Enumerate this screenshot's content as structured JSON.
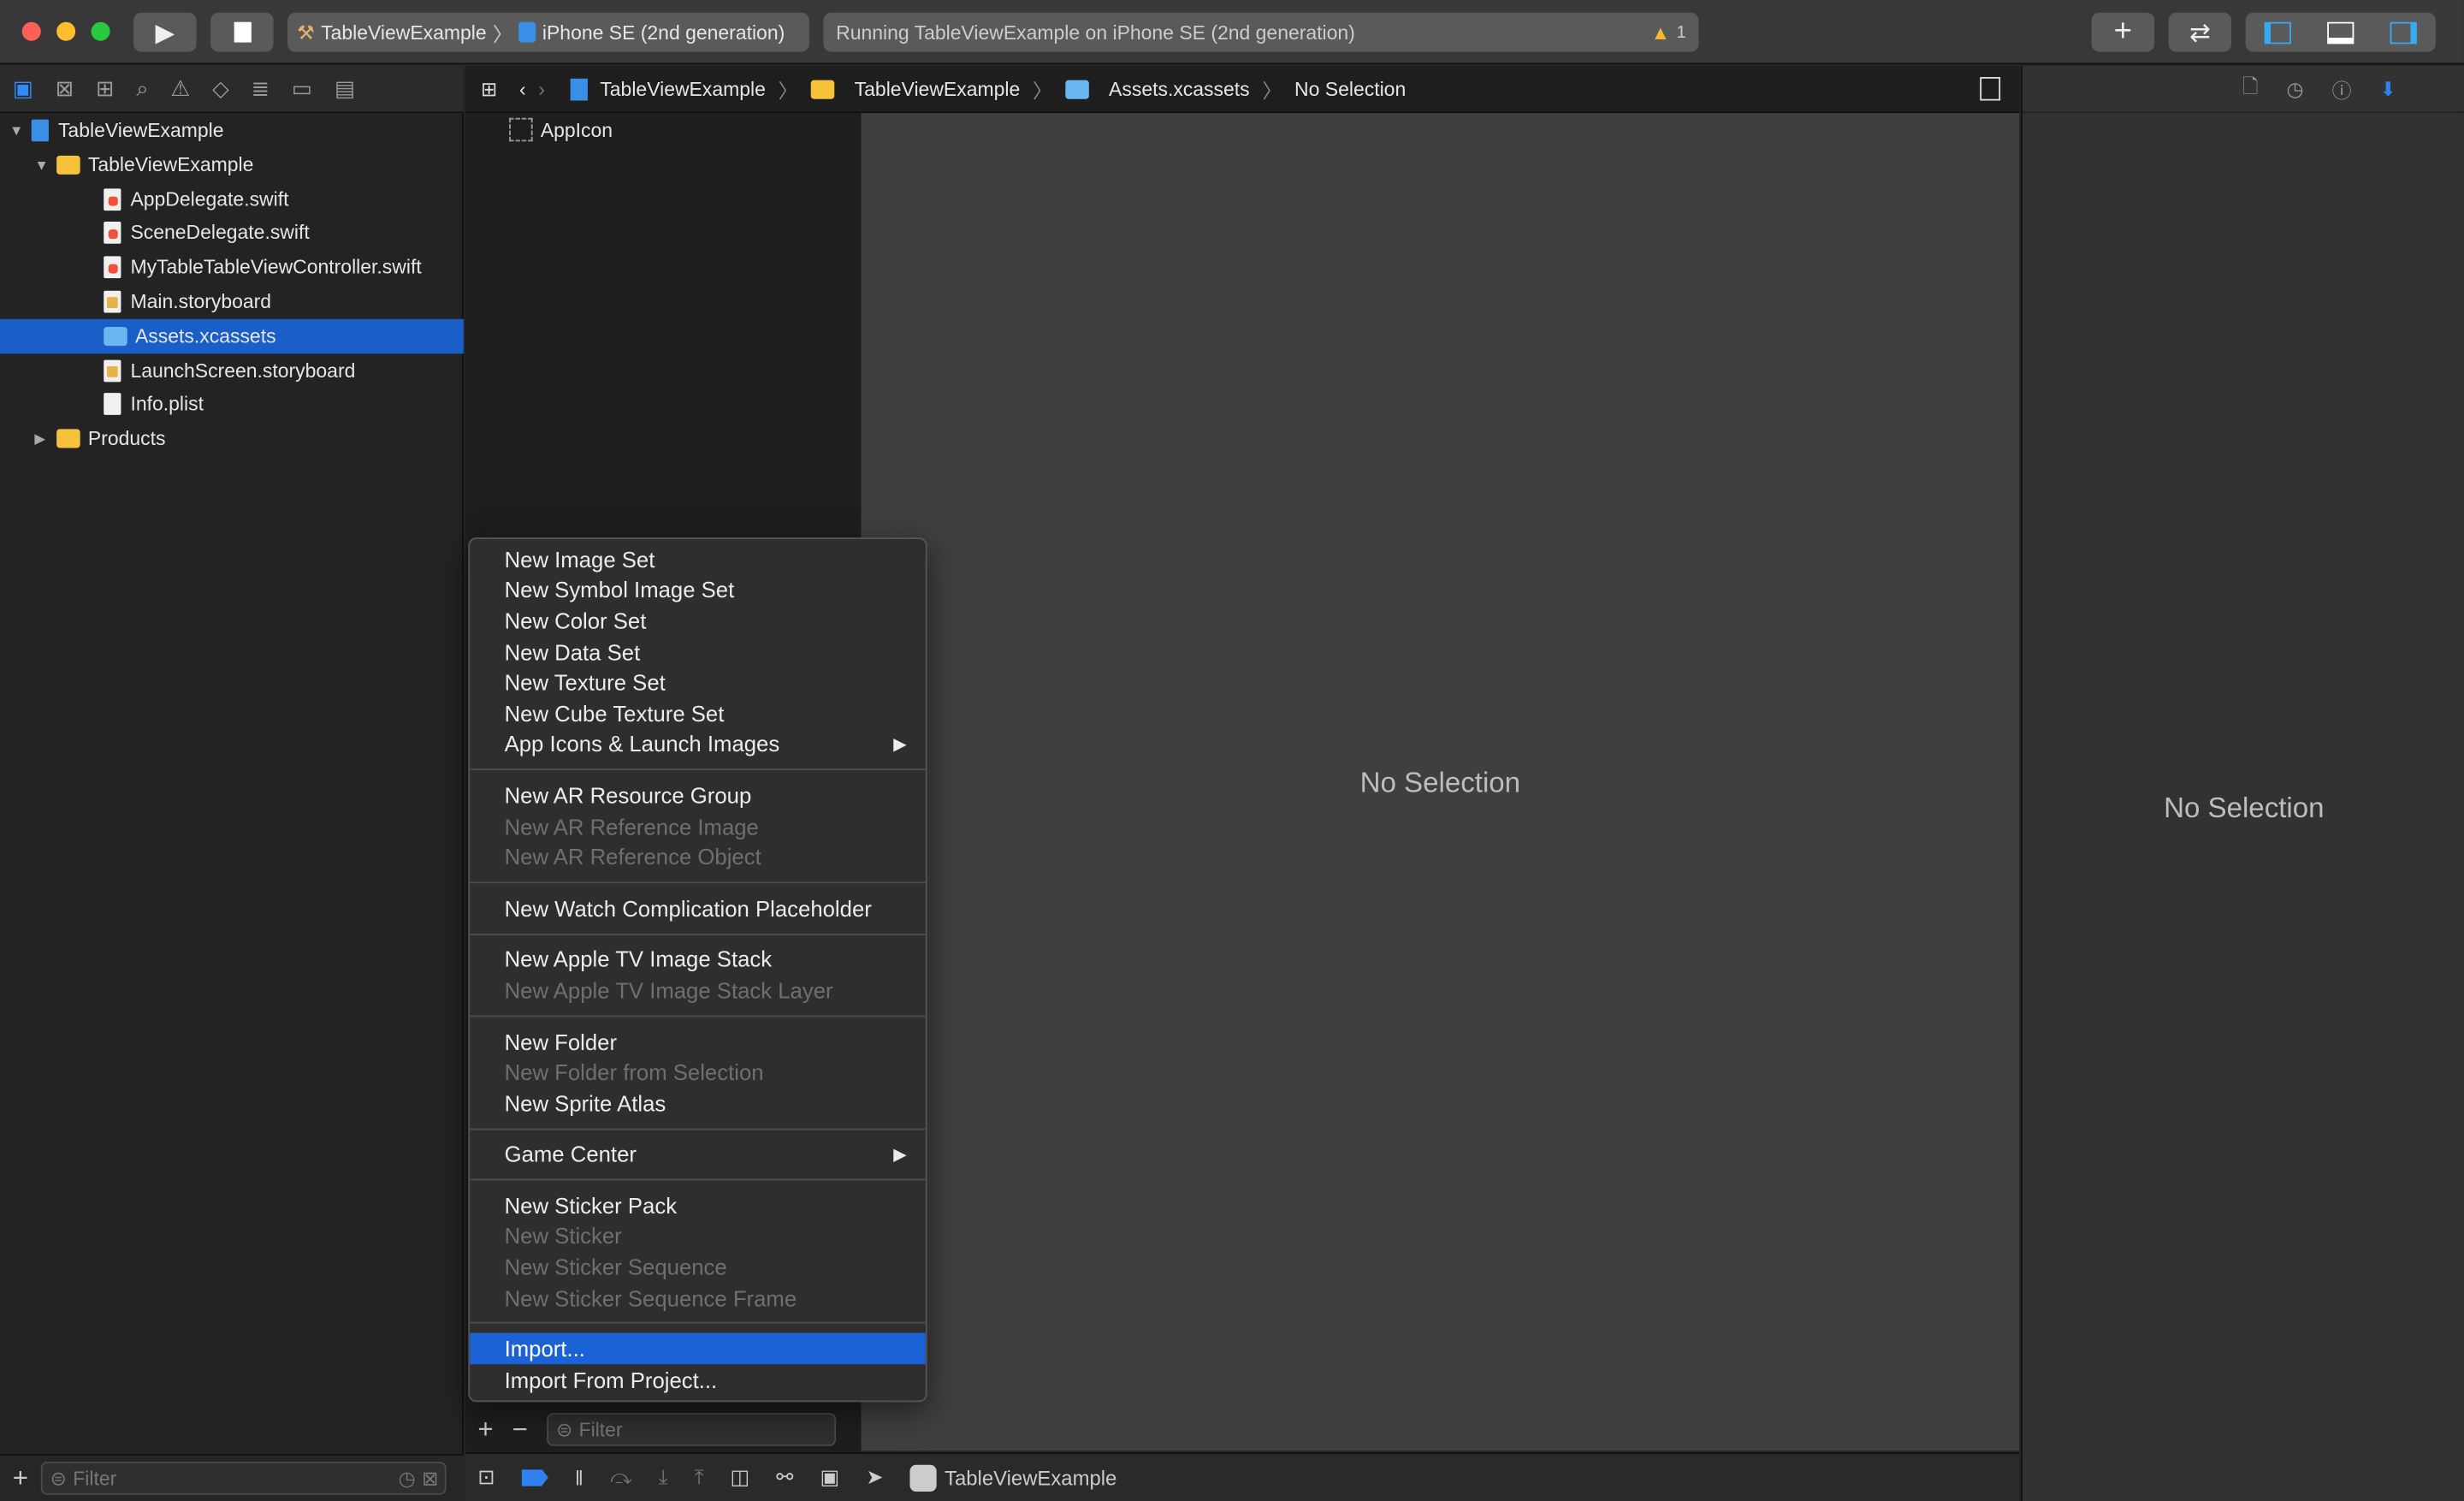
{
  "toolbar": {
    "scheme": "TableViewExample",
    "device": "iPhone SE (2nd generation)",
    "status": "Running TableViewExample on iPhone SE (2nd generation)",
    "warning_count": "1"
  },
  "jumpbar": {
    "crumbs": [
      "TableViewExample",
      "TableViewExample",
      "Assets.xcassets",
      "No Selection"
    ]
  },
  "navigator": {
    "items": [
      {
        "label": "TableViewExample",
        "type": "project",
        "level": 0,
        "expanded": true
      },
      {
        "label": "TableViewExample",
        "type": "folder",
        "level": 1,
        "expanded": true
      },
      {
        "label": "AppDelegate.swift",
        "type": "swift",
        "level": 2
      },
      {
        "label": "SceneDelegate.swift",
        "type": "swift",
        "level": 2
      },
      {
        "label": "MyTableTableViewController.swift",
        "type": "swift",
        "level": 2
      },
      {
        "label": "Main.storyboard",
        "type": "storyboard",
        "level": 2
      },
      {
        "label": "Assets.xcassets",
        "type": "assets",
        "level": 2,
        "selected": true
      },
      {
        "label": "LaunchScreen.storyboard",
        "type": "storyboard",
        "level": 2
      },
      {
        "label": "Info.plist",
        "type": "plist",
        "level": 2
      },
      {
        "label": "Products",
        "type": "folder",
        "level": 1,
        "expanded": false
      }
    ],
    "filter_placeholder": "Filter"
  },
  "assets": {
    "items": [
      "AppIcon"
    ],
    "filter_placeholder": "Filter"
  },
  "editor": {
    "empty_text": "No Selection"
  },
  "inspector": {
    "empty_text": "No Selection"
  },
  "context_menu": {
    "groups": [
      [
        {
          "label": "New Image Set"
        },
        {
          "label": "New Symbol Image Set"
        },
        {
          "label": "New Color Set"
        },
        {
          "label": "New Data Set"
        },
        {
          "label": "New Texture Set"
        },
        {
          "label": "New Cube Texture Set"
        },
        {
          "label": "App Icons & Launch Images",
          "submenu": true
        }
      ],
      [
        {
          "label": "New AR Resource Group"
        },
        {
          "label": "New AR Reference Image",
          "disabled": true
        },
        {
          "label": "New AR Reference Object",
          "disabled": true
        }
      ],
      [
        {
          "label": "New Watch Complication Placeholder"
        }
      ],
      [
        {
          "label": "New Apple TV Image Stack"
        },
        {
          "label": "New Apple TV Image Stack Layer",
          "disabled": true
        }
      ],
      [
        {
          "label": "New Folder"
        },
        {
          "label": "New Folder from Selection",
          "disabled": true
        },
        {
          "label": "New Sprite Atlas"
        }
      ],
      [
        {
          "label": "Game Center",
          "submenu": true
        }
      ],
      [
        {
          "label": "New Sticker Pack"
        },
        {
          "label": "New Sticker",
          "disabled": true
        },
        {
          "label": "New Sticker Sequence",
          "disabled": true
        },
        {
          "label": "New Sticker Sequence Frame",
          "disabled": true
        }
      ],
      [
        {
          "label": "Import...",
          "highlighted": true
        },
        {
          "label": "Import From Project..."
        }
      ]
    ]
  },
  "debugbar": {
    "target": "TableViewExample"
  },
  "colors": {
    "accent": "#1a62d6",
    "selection": "#1a5fc7",
    "warning": "#f5b82e"
  }
}
